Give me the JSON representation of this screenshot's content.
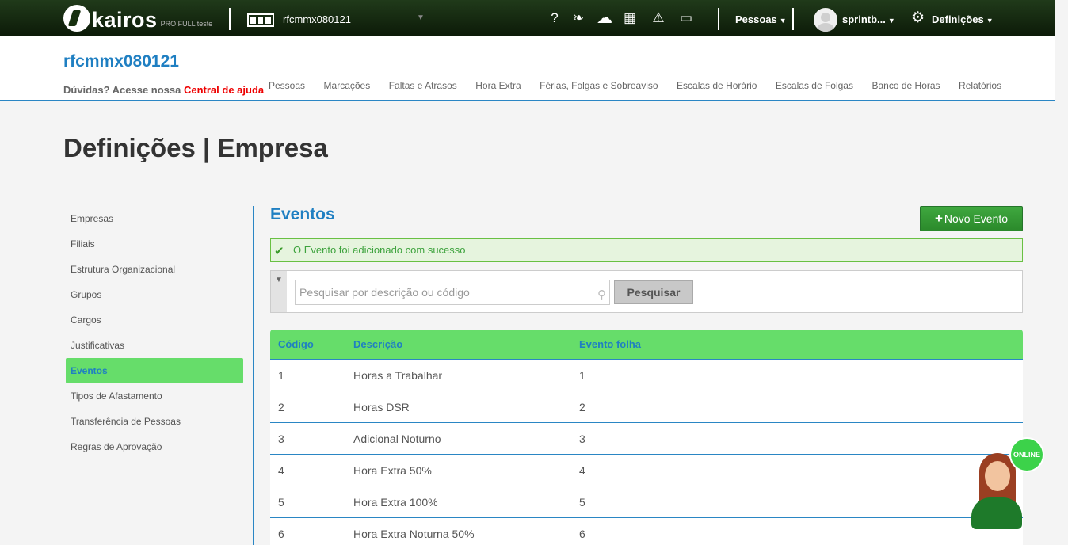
{
  "topbar": {
    "logo_text": "kairos",
    "logo_sub": "PRO FULL teste",
    "company": "rfcmmx080121",
    "icons": [
      "help-icon",
      "leaf-icon",
      "cloud-upload-icon",
      "calculator-icon",
      "warning-icon",
      "inbox-icon"
    ],
    "help_glyph": "?",
    "leaf_glyph": "❧",
    "cloud_glyph": "☁",
    "calc_glyph": "▦",
    "warn_glyph": "⚠",
    "inbox_glyph": "▭",
    "pessoas_label": "Pessoas",
    "user_label": "sprintb...",
    "defs_label": "Definições",
    "caret": "▼",
    "gear_glyph": "⚙"
  },
  "header": {
    "company_title": "rfcmmx080121",
    "help_text": "Dúvidas? Acesse nossa ",
    "help_link": "Central de ajuda",
    "nav": [
      "Pessoas",
      "Marcações",
      "Faltas e Atrasos",
      "Hora Extra",
      "Férias, Folgas e Sobreaviso",
      "Escalas de Horário",
      "Escalas de Folgas",
      "Banco de Horas",
      "Relatórios"
    ]
  },
  "page_title": "Definições | Empresa",
  "sidebar": {
    "items": [
      "Empresas",
      "Filiais",
      "Estrutura Organizacional",
      "Grupos",
      "Cargos",
      "Justificativas",
      "Eventos",
      "Tipos de Afastamento",
      "Transferência de Pessoas",
      "Regras de Aprovação"
    ],
    "active": "Eventos"
  },
  "main": {
    "section_title": "Eventos",
    "new_button": "Novo Evento",
    "new_button_icon": "+",
    "success_message": "O Evento foi adicionado com sucesso",
    "check_glyph": "✔",
    "filter_glyph": "▼",
    "search_placeholder": "Pesquisar por descrição ou código",
    "search_glyph": "⚲",
    "search_button": "Pesquisar"
  },
  "table": {
    "headers": [
      "Código",
      "Descrição",
      "Evento folha"
    ],
    "rows": [
      [
        "1",
        "Horas a Trabalhar",
        "1"
      ],
      [
        "2",
        "Horas DSR",
        "2"
      ],
      [
        "3",
        "Adicional Noturno",
        "3"
      ],
      [
        "4",
        "Hora Extra 50%",
        "4"
      ],
      [
        "5",
        "Hora Extra 100%",
        "5"
      ],
      [
        "6",
        "Hora Extra Noturna 50%",
        "6"
      ]
    ]
  },
  "chat": {
    "online_label": "ONLINE"
  }
}
